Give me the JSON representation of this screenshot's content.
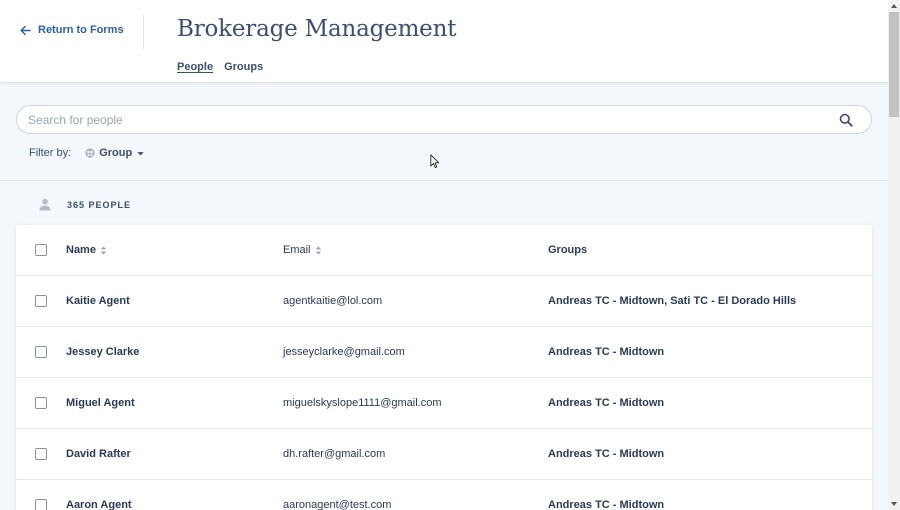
{
  "header": {
    "back_label": "Return to Forms",
    "title": "Brokerage Management",
    "tabs": [
      {
        "label": "People",
        "active": true
      },
      {
        "label": "Groups",
        "active": false
      }
    ]
  },
  "search": {
    "placeholder": "Search for people",
    "value": ""
  },
  "filter": {
    "label": "Filter by:",
    "group_label": "Group"
  },
  "count": {
    "label": "365 PEOPLE"
  },
  "table": {
    "columns": {
      "name": "Name",
      "email": "Email",
      "groups": "Groups"
    },
    "rows": [
      {
        "name": "Kaitie Agent",
        "email": "agentkaitie@lol.com",
        "groups": "Andreas TC - Midtown, Sati TC - El Dorado Hills"
      },
      {
        "name": "Jessey Clarke",
        "email": "jesseyclarke@gmail.com",
        "groups": "Andreas TC - Midtown"
      },
      {
        "name": "Miguel Agent",
        "email": "miguelskyslope1111@gmail.com",
        "groups": "Andreas TC - Midtown"
      },
      {
        "name": "David Rafter",
        "email": "dh.rafter@gmail.com",
        "groups": "Andreas TC - Midtown"
      },
      {
        "name": "Aaron Agent",
        "email": "aaronagent@test.com",
        "groups": "Andreas TC - Midtown"
      }
    ]
  },
  "colors": {
    "accent": "#2a5fb0",
    "text": "#2b3b55",
    "background": "#f4f7fb"
  }
}
